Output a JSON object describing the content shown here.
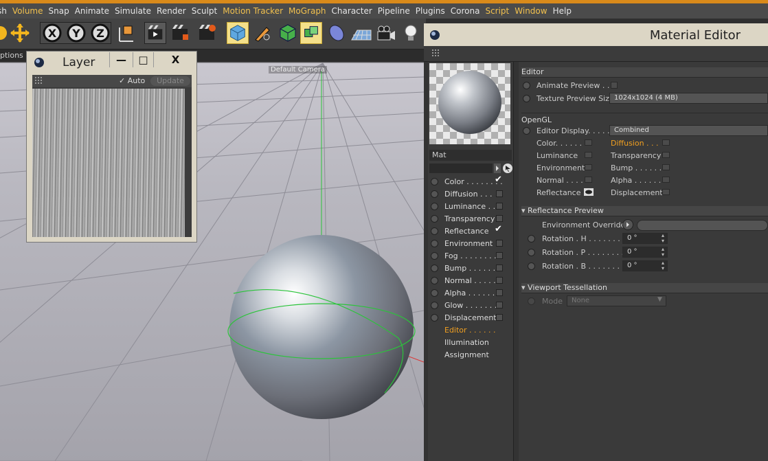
{
  "menu": [
    "sh",
    "Volume",
    "Snap",
    "Animate",
    "Simulate",
    "Render",
    "Sculpt",
    "Motion Tracker",
    "MoGraph",
    "Character",
    "Pipeline",
    "Plugins",
    "Corona",
    "Script",
    "Window",
    "Help"
  ],
  "viewport": {
    "options_tab": "ptions",
    "camera_label": "Default Camera"
  },
  "layer_window": {
    "title": "Layer",
    "minimize": "—",
    "maximize": "□",
    "close": "X",
    "auto_label": "✓ Auto",
    "update_label": "Update"
  },
  "material_editor": {
    "title": "Material Editor",
    "material_name": "Mat",
    "channels": [
      {
        "label": "Color . . . . . . . .",
        "checked": true
      },
      {
        "label": "Diffusion . . .",
        "checked": false
      },
      {
        "label": "Luminance . .",
        "checked": false
      },
      {
        "label": "Transparency",
        "checked": false
      },
      {
        "label": "Reflectance",
        "checked": true
      },
      {
        "label": "Environment",
        "checked": false
      },
      {
        "label": "Fog . . . . . . . .",
        "checked": false
      },
      {
        "label": "Bump . . . . . . .",
        "checked": false
      },
      {
        "label": "Normal . . . . .",
        "checked": false
      },
      {
        "label": "Alpha . . . . . .",
        "checked": false
      },
      {
        "label": "Glow . . . . . . .",
        "checked": false
      },
      {
        "label": "Displacement",
        "checked": false
      }
    ],
    "extra_items": [
      "Editor . . . . . .",
      "Illumination",
      "Assignment"
    ],
    "editor_section": "Editor",
    "animate_preview_label": "Animate Preview . .",
    "texture_preview_label": "Texture Preview Size",
    "texture_preview_value": "1024x1024 (4 MB)",
    "opengl_section": "OpenGL",
    "editor_display_label": "Editor Display. . . . .",
    "editor_display_value": "Combined",
    "opengl_left": [
      "Color. . . . . .",
      "Luminance",
      "Environment",
      "Normal . . . . .",
      "Reflectance"
    ],
    "opengl_right": [
      "Diffusion . . .",
      "Transparency",
      "Bump . . . . . .",
      "Alpha . . . . . .",
      "Displacement"
    ],
    "reflectance_section": "Reflectance Preview",
    "env_override_label": "Environment Override",
    "rotations": [
      {
        "label": "Rotation . H . . . . . . . .",
        "value": "0 °"
      },
      {
        "label": "Rotation . P . . . . . . . .",
        "value": "0 °"
      },
      {
        "label": "Rotation . B . . . . . . . .",
        "value": "0 °"
      }
    ],
    "tessellation_section": "Viewport Tessellation",
    "mode_label": "Mode",
    "mode_value": "None"
  }
}
